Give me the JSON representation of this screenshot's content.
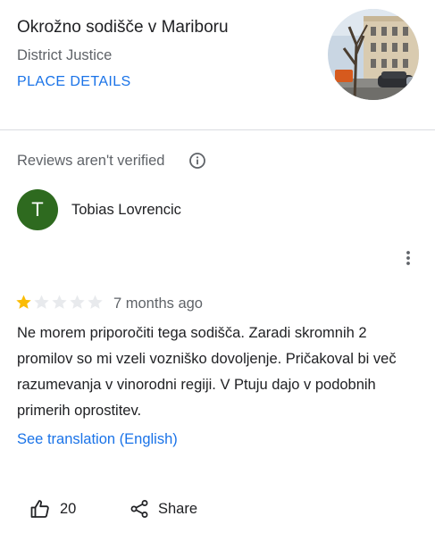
{
  "place": {
    "name": "Okrožno sodišče v Mariboru",
    "category": "District Justice",
    "details_link": "PLACE DETAILS",
    "photo_icon": "court-building-photo"
  },
  "review": {
    "unverified_notice": "Reviews aren't verified",
    "info_icon": "info-icon",
    "reviewer": {
      "initial": "T",
      "name": "Tobias Lovrencic",
      "avatar_color": "#2e6a1f"
    },
    "rating": 1,
    "rating_max": 5,
    "time": "7 months ago",
    "text": "Ne morem priporočiti tega sodišča. Zaradi skromnih 2 promilov so mi vzeli vozniško dovoljenje. Pričakoval bi več razumevanja v vinorodni regiji. V Ptuju dajo v podobnih primerih oprostitev.",
    "translation_link": "See translation (English)",
    "likes": "20",
    "share_label": "Share"
  },
  "colors": {
    "accent": "#1a73e8",
    "star_filled": "#fbbc04",
    "star_empty": "#e8eaed",
    "secondary_text": "#5f6368",
    "divider": "#dadce0"
  }
}
